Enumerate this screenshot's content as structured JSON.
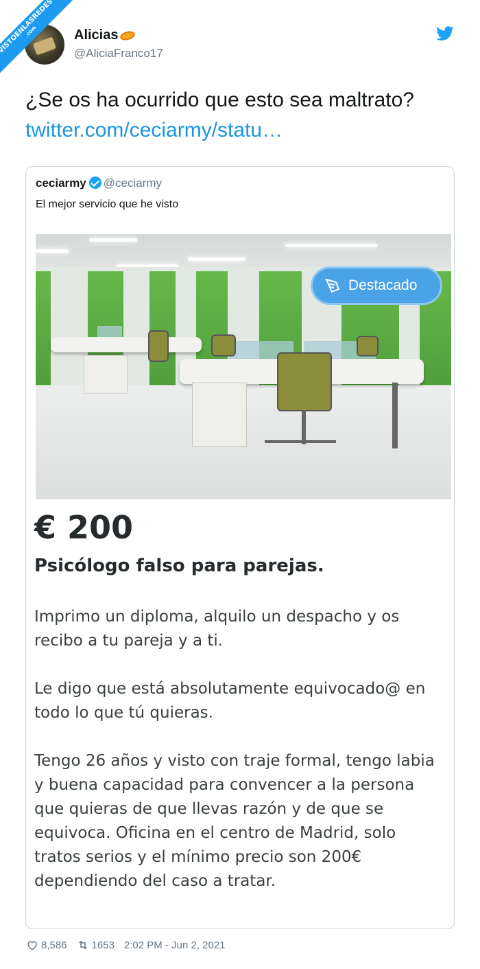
{
  "watermark": {
    "line1": "VISTOENLASREDES",
    "line2": ".com"
  },
  "author": {
    "name": "Alicias",
    "handle": "@AliciaFranco17"
  },
  "tweet": {
    "text": "¿Se os ha ocurrido que esto sea maltrato? ",
    "link": "twitter.com/ceciarmy/statu…"
  },
  "quoted": {
    "name": "ceciarmy",
    "handle": "@ceciarmy",
    "text": "El mejor servicio que he visto",
    "badge_label": "Destacado",
    "price": "€ 200",
    "ad_title": "Psicólogo falso para parejas.",
    "paragraphs": [
      "Imprimo un diploma, alquilo un despacho y os recibo a tu pareja y a ti.",
      "Le digo que está absolutamente equivocado@ en todo lo que tú quieras.",
      "Tengo 26 años y visto con traje formal, tengo labia y buena capacidad para convencer a la persona que quieras de que llevas razón y de que se equivoca. Oficina en el centro de Madrid, solo tratos serios y el mínimo precio son 200€ dependiendo del caso a tratar."
    ]
  },
  "footer": {
    "likes": "8,586",
    "retweets": "1653",
    "timestamp": "2:02 PM - Jun 2, 2021"
  },
  "colors": {
    "link": "#1b95e0",
    "twitter_blue": "#1da1f2",
    "badge": "#4aa3e6",
    "muted": "#657786"
  },
  "icons": {
    "brand": "twitter-bird-icon",
    "verified": "verified-badge-icon",
    "like": "heart-icon",
    "retweet": "retweet-icon",
    "badge": "wings-icon"
  }
}
